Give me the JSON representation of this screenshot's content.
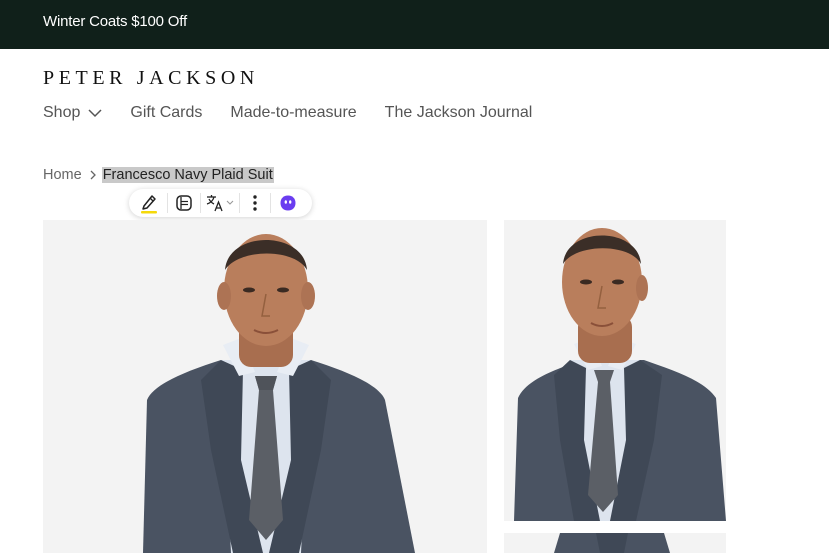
{
  "promo": {
    "text": "Winter Coats $100 Off"
  },
  "brand": {
    "logo": "PETER JACKSON"
  },
  "nav": {
    "items": [
      {
        "label": "Shop"
      },
      {
        "label": "Gift Cards"
      },
      {
        "label": "Made-to-measure"
      },
      {
        "label": "The Jackson Journal"
      }
    ]
  },
  "breadcrumb": {
    "home": "Home",
    "current": "Francesco Navy Plaid Suit"
  },
  "selection_toolbar": {
    "icons": [
      "highlighter-icon",
      "note-icon",
      "translate-icon",
      "more-options-icon",
      "assistant-icon"
    ]
  },
  "colors": {
    "promo_bg": "#10201a",
    "suit": "#4a5362",
    "shirt": "#dde4ee",
    "skin": "#b97e5c",
    "assistant": "#6a3df0",
    "highlighter_underline": "#f5d90a"
  }
}
